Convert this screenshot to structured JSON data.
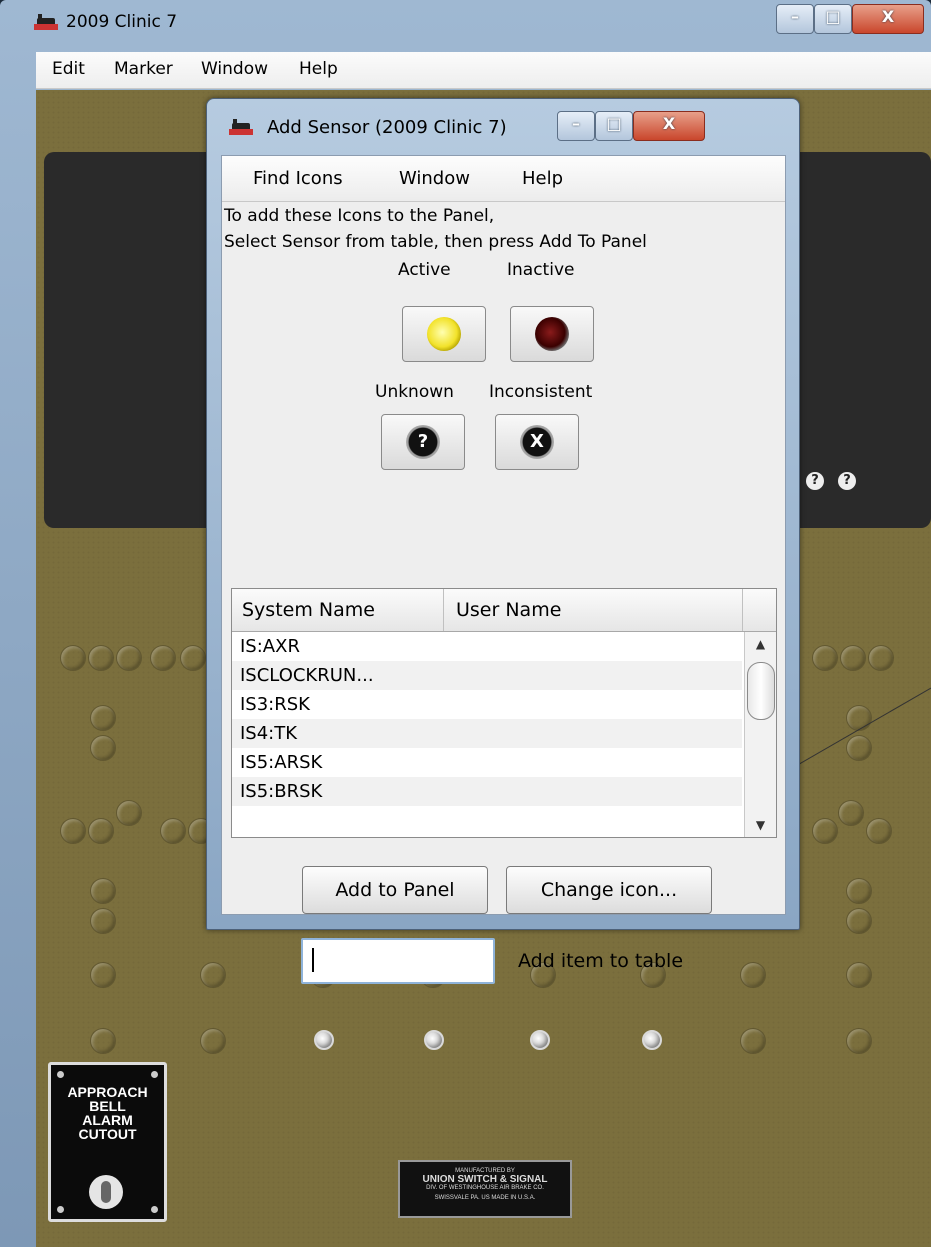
{
  "main_window": {
    "title": "2009 Clinic 7",
    "menu": [
      "Edit",
      "Marker",
      "Window",
      "Help"
    ],
    "controls": {
      "minimize": "–",
      "maximize": "□",
      "close": "X"
    }
  },
  "panel": {
    "approach_plate": {
      "line1": "APPROACH",
      "line2": "BELL",
      "line3": "ALARM",
      "line4": "CUTOUT"
    },
    "maker_plate": {
      "line1": "MANUFACTURED BY",
      "line2": "UNION SWITCH & SIGNAL",
      "line3": "DIV. OF WESTINGHOUSE AIR BRAKE CO.",
      "line4": "SWISSVALE PA.  US  MADE IN U.S.A."
    },
    "unknown_marker": "?"
  },
  "dialog": {
    "title": "Add Sensor (2009 Clinic 7)",
    "menu": [
      "Find Icons",
      "Window",
      "Help"
    ],
    "instructions": [
      "To add these Icons to the Panel,",
      "Select Sensor from table, then press Add To Panel"
    ],
    "icons": [
      {
        "label": "Active",
        "glyph": ""
      },
      {
        "label": "Inactive",
        "glyph": ""
      },
      {
        "label": "Unknown",
        "glyph": "?"
      },
      {
        "label": "Inconsistent",
        "glyph": "X"
      }
    ],
    "table": {
      "columns": [
        "System Name",
        "User Name"
      ],
      "rows": [
        {
          "system_name": "IS:AXR",
          "user_name": ""
        },
        {
          "system_name": "ISCLOCKRUN...",
          "user_name": ""
        },
        {
          "system_name": "IS3:RSK",
          "user_name": ""
        },
        {
          "system_name": "IS4:TK",
          "user_name": ""
        },
        {
          "system_name": "IS5:ARSK",
          "user_name": ""
        },
        {
          "system_name": "IS5:BRSK",
          "user_name": ""
        }
      ],
      "scroll_up": "▲",
      "scroll_down": "▼"
    },
    "buttons": {
      "add_to_panel": "Add to Panel",
      "change_icon": "Change icon..."
    },
    "add_item": {
      "value": "",
      "label": "Add item to table"
    }
  },
  "colors": {
    "panel_bg": "#7b6f3d",
    "panel_dark": "#2a2a2a",
    "active_yellow": "#f2e22a",
    "inactive_red": "#3a0000"
  }
}
